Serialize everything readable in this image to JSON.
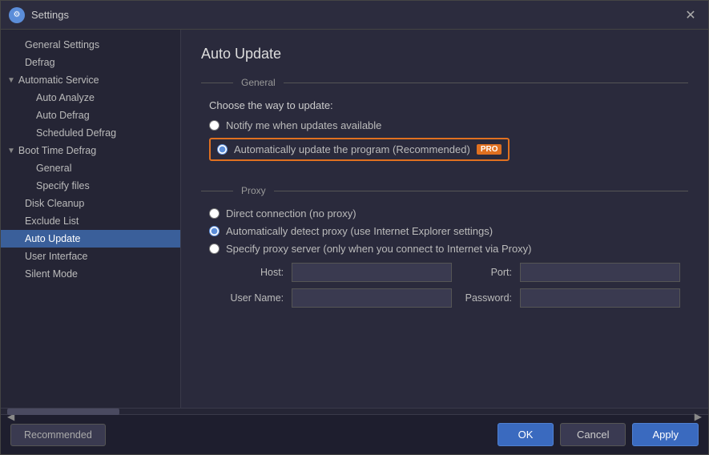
{
  "titleBar": {
    "title": "Settings",
    "closeLabel": "✕"
  },
  "sidebar": {
    "items": [
      {
        "id": "general-settings",
        "label": "General Settings",
        "indent": "indent1",
        "active": false
      },
      {
        "id": "defrag",
        "label": "Defrag",
        "indent": "indent1",
        "active": false
      },
      {
        "id": "automatic-service",
        "label": "Automatic Service",
        "indent": "group",
        "expander": "▼",
        "active": false
      },
      {
        "id": "auto-analyze",
        "label": "Auto Analyze",
        "indent": "indent2",
        "active": false
      },
      {
        "id": "auto-defrag",
        "label": "Auto Defrag",
        "indent": "indent2",
        "active": false
      },
      {
        "id": "scheduled-defrag",
        "label": "Scheduled Defrag",
        "indent": "indent2",
        "active": false
      },
      {
        "id": "boot-time-defrag",
        "label": "Boot Time Defrag",
        "indent": "group",
        "expander": "▼",
        "active": false
      },
      {
        "id": "general",
        "label": "General",
        "indent": "indent2",
        "active": false
      },
      {
        "id": "specify-files",
        "label": "Specify files",
        "indent": "indent2",
        "active": false
      },
      {
        "id": "disk-cleanup",
        "label": "Disk Cleanup",
        "indent": "indent1",
        "active": false
      },
      {
        "id": "exclude-list",
        "label": "Exclude List",
        "indent": "indent1",
        "active": false
      },
      {
        "id": "auto-update",
        "label": "Auto Update",
        "indent": "indent1",
        "active": true
      },
      {
        "id": "user-interface",
        "label": "User Interface",
        "indent": "indent1",
        "active": false
      },
      {
        "id": "silent-mode",
        "label": "Silent Mode",
        "indent": "indent1",
        "active": false
      }
    ]
  },
  "main": {
    "pageTitle": "Auto Update",
    "general": {
      "sectionLabel": "General",
      "subtitle": "Choose the way to update:",
      "radio1Label": "Notify me when updates available",
      "radio2Label": "Automatically update the program (Recommended)",
      "proBadge": "PRO"
    },
    "proxy": {
      "sectionLabel": "Proxy",
      "radio1Label": "Direct connection (no proxy)",
      "radio2Label": "Automatically detect proxy (use Internet Explorer settings)",
      "radio3Label": "Specify proxy server (only when you connect to Internet via Proxy)",
      "hostLabel": "Host:",
      "portLabel": "Port:",
      "userNameLabel": "User Name:",
      "passwordLabel": "Password:",
      "hostValue": "",
      "portValue": "",
      "userNameValue": "",
      "passwordValue": ""
    }
  },
  "bottomBar": {
    "recommendedLabel": "Recommended",
    "okLabel": "OK",
    "cancelLabel": "Cancel",
    "applyLabel": "Apply"
  }
}
